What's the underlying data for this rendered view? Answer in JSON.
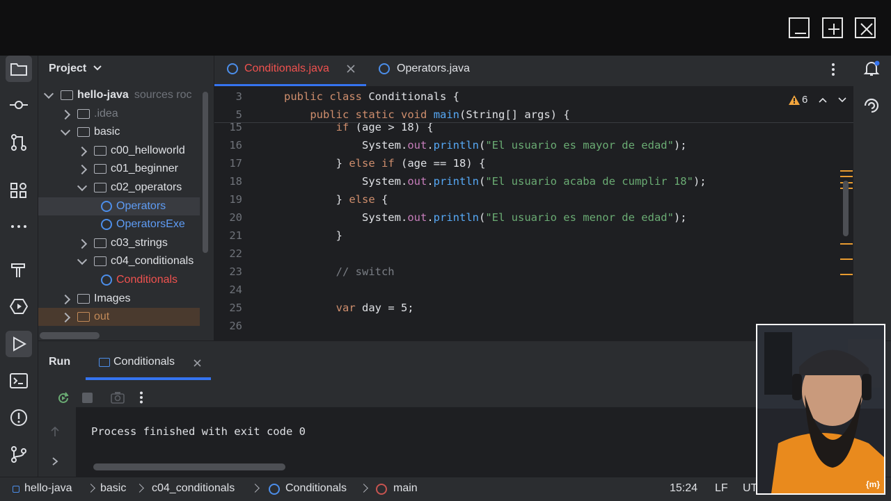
{
  "window_controls": {
    "minimize": "minimize-icon",
    "maximize": "plus-icon",
    "close": "close-icon"
  },
  "project_panel": {
    "title": "Project",
    "tree": [
      {
        "label": "hello-java",
        "suffix": "sources roc",
        "depth": 0,
        "kind": "module",
        "expanded": true
      },
      {
        "label": ".idea",
        "depth": 1,
        "kind": "folder",
        "expanded": false,
        "muted": true
      },
      {
        "label": "basic",
        "depth": 1,
        "kind": "folder",
        "expanded": true
      },
      {
        "label": "c00_helloworld",
        "depth": 2,
        "kind": "folder",
        "expanded": false
      },
      {
        "label": "c01_beginner",
        "depth": 2,
        "kind": "folder",
        "expanded": false
      },
      {
        "label": "c02_operators",
        "depth": 2,
        "kind": "folder",
        "expanded": true
      },
      {
        "label": "Operators",
        "depth": 3,
        "kind": "class",
        "selected": true
      },
      {
        "label": "OperatorsExe",
        "depth": 3,
        "kind": "class"
      },
      {
        "label": "c03_strings",
        "depth": 2,
        "kind": "folder",
        "expanded": false
      },
      {
        "label": "c04_conditionals",
        "depth": 2,
        "kind": "folder",
        "expanded": true
      },
      {
        "label": "Conditionals",
        "depth": 3,
        "kind": "class",
        "error": true
      },
      {
        "label": "Images",
        "depth": 1,
        "kind": "folder",
        "expanded": false
      },
      {
        "label": "out",
        "depth": 1,
        "kind": "folder",
        "expanded": false,
        "excluded": true
      }
    ]
  },
  "editor": {
    "tabs": [
      {
        "label": "Conditionals.java",
        "active": true,
        "error": true
      },
      {
        "label": "Operators.java",
        "active": false
      }
    ],
    "warnings_count": "6",
    "sticky_lines": [
      {
        "num": "3",
        "text": "public class Conditionals {"
      },
      {
        "num": "5",
        "text": "    public static void main(String[] args) {"
      }
    ],
    "lines": [
      {
        "num": "15",
        "text": "        if (age > 18) {"
      },
      {
        "num": "16",
        "text": "            System.out.println(\"El usuario es mayor de edad\");"
      },
      {
        "num": "17",
        "text": "        } else if (age == 18) {"
      },
      {
        "num": "18",
        "text": "            System.out.println(\"El usuario acaba de cumplir 18\");"
      },
      {
        "num": "19",
        "text": "        } else {"
      },
      {
        "num": "20",
        "text": "            System.out.println(\"El usuario es menor de edad\");"
      },
      {
        "num": "21",
        "text": "        }"
      },
      {
        "num": "22",
        "text": ""
      },
      {
        "num": "23",
        "text": "        // switch"
      },
      {
        "num": "24",
        "text": ""
      },
      {
        "num": "25",
        "text": "        var day = 5;"
      },
      {
        "num": "26",
        "text": ""
      }
    ]
  },
  "run_panel": {
    "title": "Run",
    "tab_label": "Conditionals",
    "output": "Process finished with exit code 0"
  },
  "status_bar": {
    "breadcrumbs": [
      "hello-java",
      "basic",
      "c04_conditionals",
      "Conditionals",
      "main"
    ],
    "position": "15:24",
    "line_separator": "LF",
    "encoding": "UT"
  },
  "webcam_badge": "{m}",
  "colors": {
    "keyword": "#cf8e6d",
    "string": "#6aab73",
    "comment": "#7a7e85",
    "method": "#56a8f5",
    "field": "#c77dbb",
    "error_file": "#f0524f",
    "accent": "#3574f0",
    "warning": "#f2a53d"
  }
}
